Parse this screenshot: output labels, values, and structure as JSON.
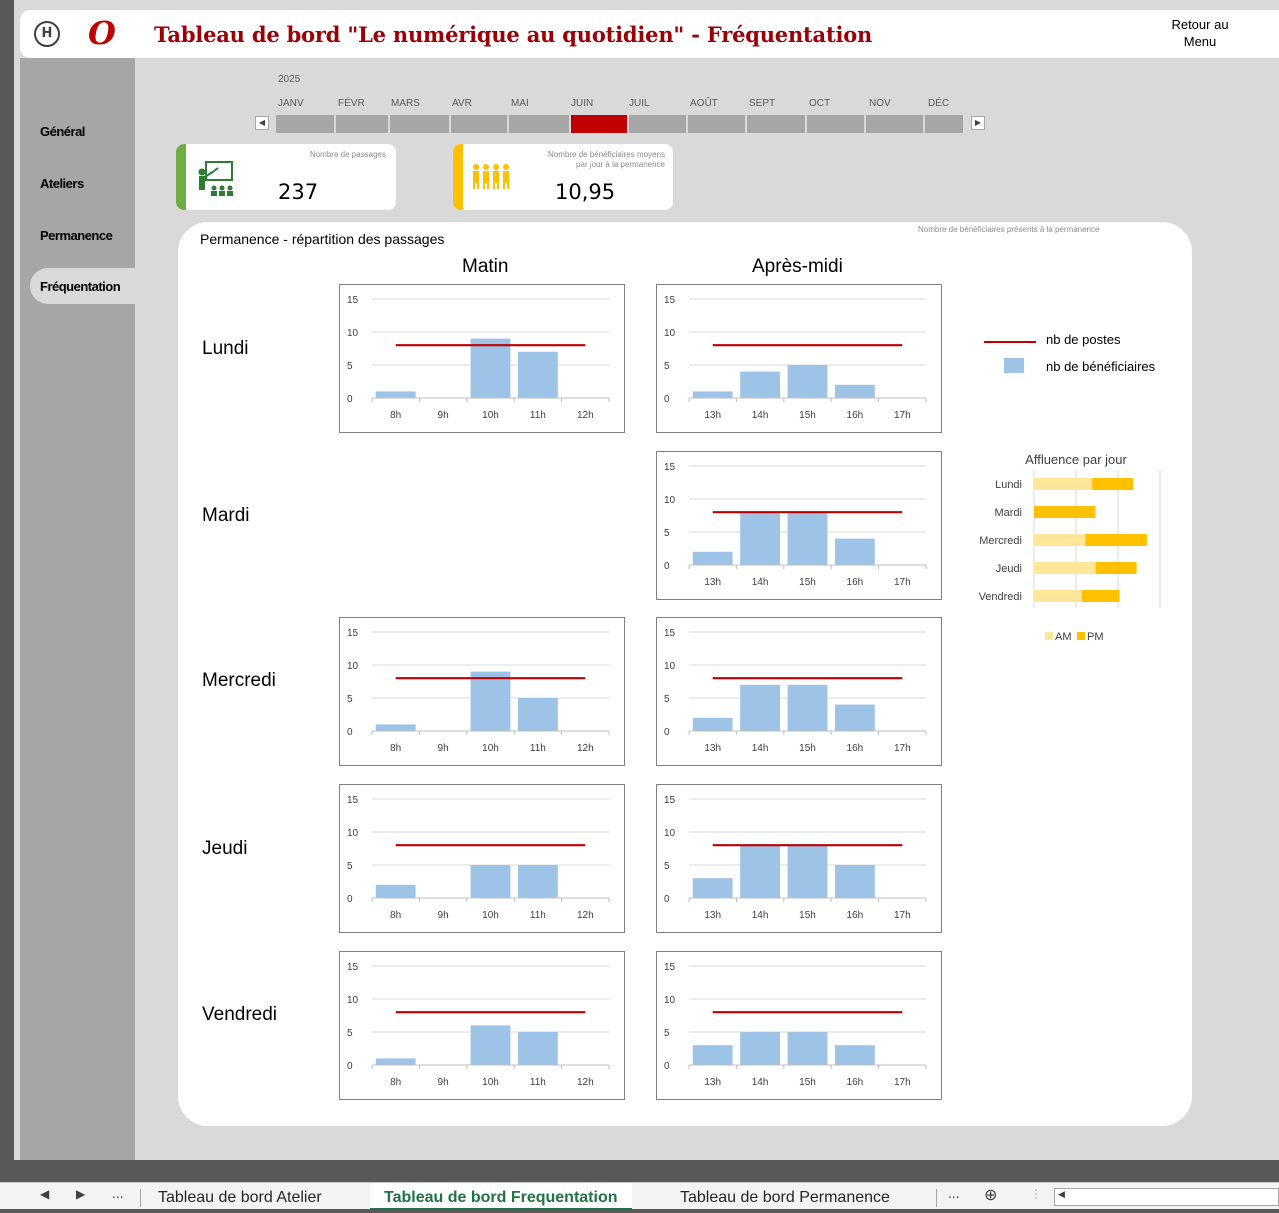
{
  "header": {
    "logo_h": "H",
    "logo_o": "O",
    "title": "Tableau de bord \"Le numérique au quotidien\" - Fréquentation",
    "retour_line1": "Retour au",
    "retour_line2": "Menu"
  },
  "sidebar": {
    "items": [
      {
        "label": "Général"
      },
      {
        "label": "Ateliers"
      },
      {
        "label": "Permanence"
      },
      {
        "label": "Fréquentation"
      }
    ],
    "active": "Fréquentation"
  },
  "timeline": {
    "year": "2025",
    "months": [
      "JANV",
      "FÉVR",
      "MARS",
      "AVR",
      "MAI",
      "JUIN",
      "JUIL",
      "AOÛT",
      "SEPT",
      "OCT",
      "NOV",
      "DÉC"
    ],
    "selected": "JUIN",
    "left_arrow": "◀",
    "right_arrow": "▶"
  },
  "kpis": {
    "passages": {
      "label": "Nombre de passages",
      "value": "237"
    },
    "beneficiaires": {
      "label_line1": "Nombre de bénéficiaires moyens",
      "label_line2": "par jour à la permanence",
      "value": "10,95"
    }
  },
  "colors": {
    "accent_red": "#c00000",
    "title_red": "#9c0006",
    "bar_blue": "#9dc3e6",
    "kpi_green": "#70ad47",
    "kpi_yellow": "#ffc000",
    "am_color": "#ffe699",
    "pm_color": "#ffc000"
  },
  "icons": {
    "kpi1": "teacher-presentation-icon",
    "kpi2": "people-group-icon"
  },
  "panel": {
    "title": "Permanence - répartition des passages",
    "note": "Nombre de bénéficiaires présents à la permanence",
    "col_matin": "Matin",
    "col_apres_midi": "Après-midi",
    "days": [
      "Lundi",
      "Mardi",
      "Mercredi",
      "Jeudi",
      "Vendredi"
    ]
  },
  "legend": {
    "postes": "nb de postes",
    "beneficiaires": "nb de bénéficiaires"
  },
  "chart_data": [
    {
      "type": "bar",
      "day": "Lundi",
      "period": "Matin",
      "categories": [
        "8h",
        "9h",
        "10h",
        "11h",
        "12h"
      ],
      "series": [
        {
          "name": "nb de bénéficiaires",
          "values": [
            1,
            0,
            9,
            7,
            0
          ]
        },
        {
          "name": "nb de postes",
          "type": "line",
          "values": [
            8,
            8,
            8,
            8,
            8
          ]
        }
      ],
      "yticks": [
        0,
        5,
        10,
        15
      ],
      "ylim": [
        0,
        15
      ]
    },
    {
      "type": "bar",
      "day": "Lundi",
      "period": "Après-midi",
      "categories": [
        "13h",
        "14h",
        "15h",
        "16h",
        "17h"
      ],
      "series": [
        {
          "name": "nb de bénéficiaires",
          "values": [
            1,
            4,
            5,
            2,
            0
          ]
        },
        {
          "name": "nb de postes",
          "type": "line",
          "values": [
            8,
            8,
            8,
            8,
            8
          ]
        }
      ],
      "yticks": [
        0,
        5,
        10,
        15
      ],
      "ylim": [
        0,
        15
      ]
    },
    {
      "type": "bar",
      "day": "Mardi",
      "period": "Après-midi",
      "categories": [
        "13h",
        "14h",
        "15h",
        "16h",
        "17h"
      ],
      "series": [
        {
          "name": "nb de bénéficiaires",
          "values": [
            2,
            8,
            8,
            4,
            0
          ]
        },
        {
          "name": "nb de postes",
          "type": "line",
          "values": [
            8,
            8,
            8,
            8,
            8
          ]
        }
      ],
      "yticks": [
        0,
        5,
        10,
        15
      ],
      "ylim": [
        0,
        15
      ]
    },
    {
      "type": "bar",
      "day": "Mercredi",
      "period": "Matin",
      "categories": [
        "8h",
        "9h",
        "10h",
        "11h",
        "12h"
      ],
      "series": [
        {
          "name": "nb de bénéficiaires",
          "values": [
            1,
            0,
            9,
            5,
            0
          ]
        },
        {
          "name": "nb de postes",
          "type": "line",
          "values": [
            8,
            8,
            8,
            8,
            8
          ]
        }
      ],
      "yticks": [
        0,
        5,
        10,
        15
      ],
      "ylim": [
        0,
        15
      ]
    },
    {
      "type": "bar",
      "day": "Mercredi",
      "period": "Après-midi",
      "categories": [
        "13h",
        "14h",
        "15h",
        "16h",
        "17h"
      ],
      "series": [
        {
          "name": "nb de bénéficiaires",
          "values": [
            2,
            7,
            7,
            4,
            0
          ]
        },
        {
          "name": "nb de postes",
          "type": "line",
          "values": [
            8,
            8,
            8,
            8,
            8
          ]
        }
      ],
      "yticks": [
        0,
        5,
        10,
        15
      ],
      "ylim": [
        0,
        15
      ]
    },
    {
      "type": "bar",
      "day": "Jeudi",
      "period": "Matin",
      "categories": [
        "8h",
        "9h",
        "10h",
        "11h",
        "12h"
      ],
      "series": [
        {
          "name": "nb de bénéficiaires",
          "values": [
            2,
            0,
            5,
            5,
            0
          ]
        },
        {
          "name": "nb de postes",
          "type": "line",
          "values": [
            8,
            8,
            8,
            8,
            8
          ]
        }
      ],
      "yticks": [
        0,
        5,
        10,
        15
      ],
      "ylim": [
        0,
        15
      ]
    },
    {
      "type": "bar",
      "day": "Jeudi",
      "period": "Après-midi",
      "categories": [
        "13h",
        "14h",
        "15h",
        "16h",
        "17h"
      ],
      "series": [
        {
          "name": "nb de bénéficiaires",
          "values": [
            3,
            8,
            8,
            5,
            0
          ]
        },
        {
          "name": "nb de postes",
          "type": "line",
          "values": [
            8,
            8,
            8,
            8,
            8
          ]
        }
      ],
      "yticks": [
        0,
        5,
        10,
        15
      ],
      "ylim": [
        0,
        15
      ]
    },
    {
      "type": "bar",
      "day": "Vendredi",
      "period": "Matin",
      "categories": [
        "8h",
        "9h",
        "10h",
        "11h",
        "12h"
      ],
      "series": [
        {
          "name": "nb de bénéficiaires",
          "values": [
            1,
            0,
            6,
            5,
            0
          ]
        },
        {
          "name": "nb de postes",
          "type": "line",
          "values": [
            8,
            8,
            8,
            8,
            8
          ]
        }
      ],
      "yticks": [
        0,
        5,
        10,
        15
      ],
      "ylim": [
        0,
        15
      ]
    },
    {
      "type": "bar",
      "day": "Vendredi",
      "period": "Après-midi",
      "categories": [
        "13h",
        "14h",
        "15h",
        "16h",
        "17h"
      ],
      "series": [
        {
          "name": "nb de bénéficiaires",
          "values": [
            3,
            5,
            5,
            3,
            0
          ]
        },
        {
          "name": "nb de postes",
          "type": "line",
          "values": [
            8,
            8,
            8,
            8,
            8
          ]
        }
      ],
      "yticks": [
        0,
        5,
        10,
        15
      ],
      "ylim": [
        0,
        15
      ]
    },
    {
      "type": "bar",
      "orientation": "horizontal",
      "stacked": true,
      "title": "Affluence par jour",
      "categories": [
        "Lundi",
        "Mardi",
        "Mercredi",
        "Jeudi",
        "Vendredi"
      ],
      "series": [
        {
          "name": "AM",
          "values": [
            17,
            0,
            15,
            18,
            14
          ]
        },
        {
          "name": "PM",
          "values": [
            12,
            18,
            18,
            12,
            11
          ]
        }
      ],
      "xlim": [
        0,
        38
      ],
      "legend": "bottom"
    }
  ],
  "tabs": {
    "nav_left": "◀",
    "nav_right": "▶",
    "more": "...",
    "items": [
      {
        "label": "Tableau de bord Atelier"
      },
      {
        "label": "Tableau de bord Frequentation"
      },
      {
        "label": "Tableau de bord Permanence"
      }
    ],
    "active": "Tableau de bord Frequentation",
    "add": "⊕",
    "scroll_left": "◀"
  }
}
